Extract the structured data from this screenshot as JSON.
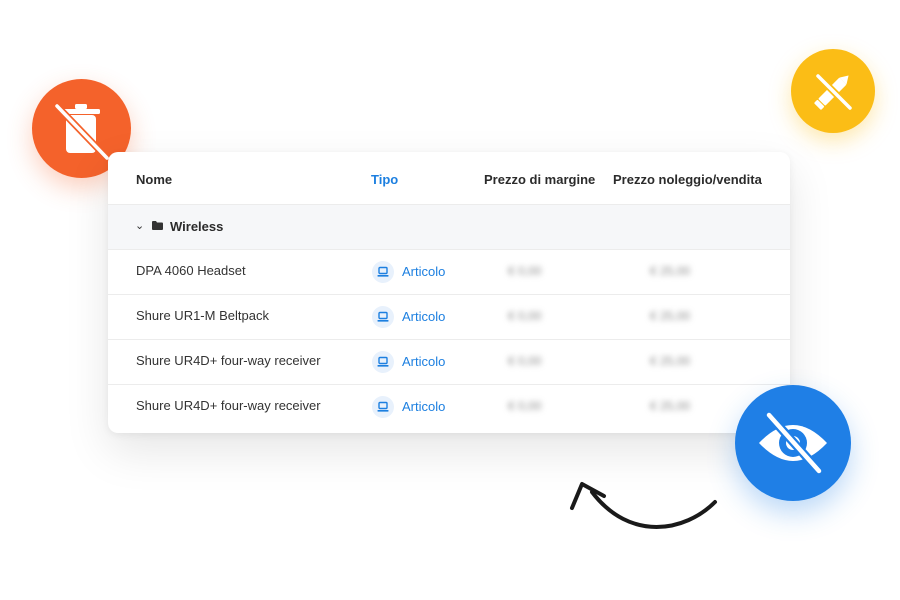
{
  "table": {
    "columns": [
      {
        "label": "Nome"
      },
      {
        "label": "Tipo"
      },
      {
        "label": "Prezzo di margine"
      },
      {
        "label": "Prezzo noleggio/vendita"
      }
    ],
    "group": {
      "name": "Wireless",
      "expand_icon": "chevron-down-icon",
      "folder_icon": "folder-icon"
    },
    "rows": [
      {
        "name": "DPA 4060 Headset",
        "type": "Articolo",
        "margin": "€ 0,00",
        "rental": "€ 25,00"
      },
      {
        "name": "Shure UR1-M Beltpack",
        "type": "Articolo",
        "margin": "€ 0,00",
        "rental": "€ 25,00"
      },
      {
        "name": "Shure UR4D+ four-way receiver",
        "type": "Articolo",
        "margin": "€ 0,00",
        "rental": "€ 25,00"
      },
      {
        "name": "Shure UR4D+ four-way receiver",
        "type": "Articolo",
        "margin": "€ 0,00",
        "rental": "€ 25,00"
      }
    ]
  },
  "badges": {
    "delete_off": {
      "icon": "trash-off-icon",
      "color": "#f4622b"
    },
    "edit_off": {
      "icon": "pencil-off-icon",
      "color": "#fbbd16"
    },
    "visibility_off": {
      "icon": "eye-off-icon",
      "color": "#1f7fe6"
    }
  },
  "colors": {
    "accent": "#1c7fe0",
    "text": "#2b2b2b",
    "row_bg": "#f6f7f9"
  }
}
